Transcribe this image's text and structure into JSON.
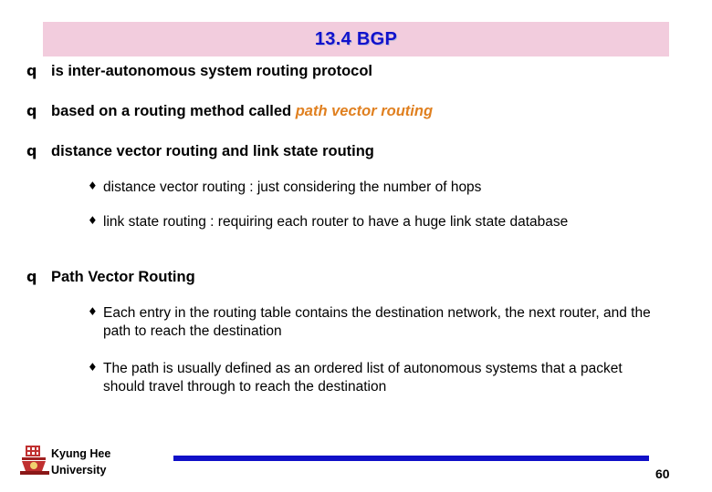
{
  "slide": {
    "title": "13.4 BGP",
    "title_color": "#1111cc",
    "title_bg": "#f2ccdd",
    "bullets": [
      {
        "level": 1,
        "marker": "q",
        "text": "is inter-autonomous system routing protocol"
      },
      {
        "level": 1,
        "marker": "q",
        "text_before": "based on a routing method called ",
        "text_emphasis": "path vector routing",
        "emphasis_color": "#e08020"
      },
      {
        "level": 1,
        "marker": "q",
        "text": "distance vector routing and link state routing"
      },
      {
        "level": 2,
        "marker": "♦",
        "text": "distance vector routing : just considering the number of hops"
      },
      {
        "level": 2,
        "marker": "♦",
        "text": "link state routing : requiring each router to have a huge link state database"
      },
      {
        "level": 1,
        "marker": "q",
        "text": "Path Vector Routing"
      },
      {
        "level": 2,
        "marker": "♦",
        "text": "Each entry in the routing table contains the destination network, the next router, and the path to reach the destination"
      },
      {
        "level": 2,
        "marker": "♦",
        "text": "The path is usually defined as an ordered list of autonomous systems that a packet should travel through to reach the destination"
      }
    ]
  },
  "footer": {
    "org_line1": "Kyung Hee",
    "org_line2": "University",
    "page_number": "60",
    "rule_color": "#1010c8"
  }
}
